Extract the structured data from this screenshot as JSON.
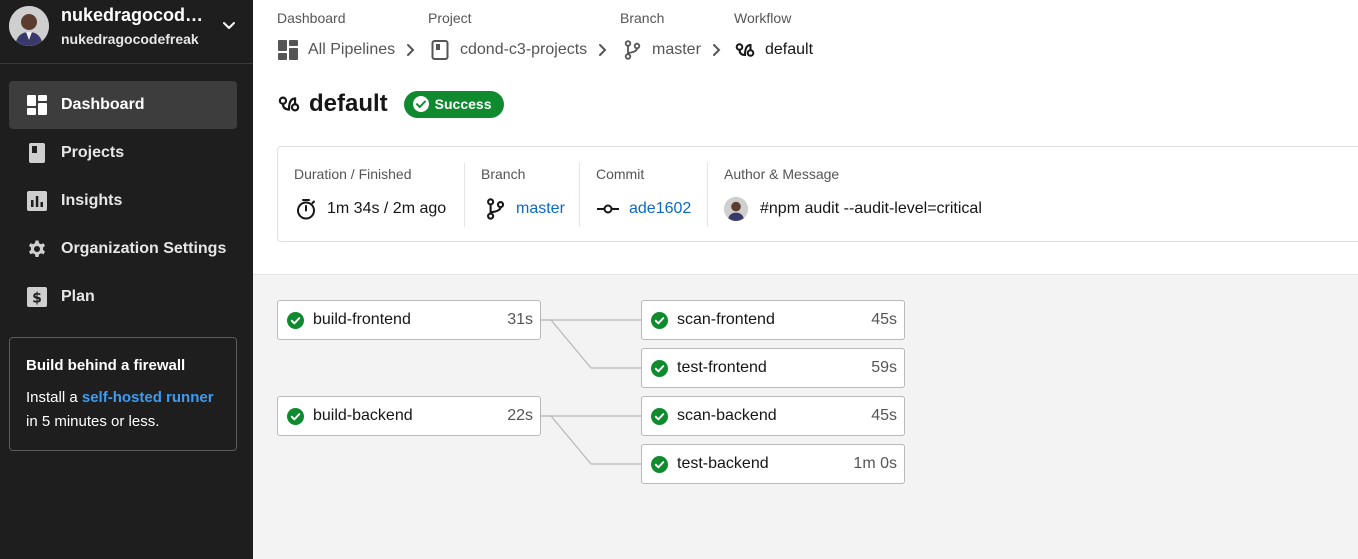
{
  "user": {
    "display_name": "nukedragocodefreak",
    "username": "nukedragocodefreak"
  },
  "nav": {
    "items": [
      {
        "label": "Dashboard",
        "icon": "dashboard-icon",
        "active": true
      },
      {
        "label": "Projects",
        "icon": "projects-icon",
        "active": false
      },
      {
        "label": "Insights",
        "icon": "insights-icon",
        "active": false
      },
      {
        "label": "Organization Settings",
        "icon": "gear-icon",
        "active": false
      },
      {
        "label": "Plan",
        "icon": "dollar-icon",
        "active": false
      }
    ]
  },
  "promo": {
    "title": "Build behind a firewall",
    "text_before": "Install a ",
    "link": "self-hosted runner",
    "text_after": " in 5 minutes or less."
  },
  "breadcrumb": {
    "items": [
      {
        "caption": "Dashboard",
        "label": "All Pipelines",
        "icon": "pipelines-icon"
      },
      {
        "caption": "Project",
        "label": "cdond-c3-projects",
        "icon": "project-icon"
      },
      {
        "caption": "Branch",
        "label": "master",
        "icon": "branch-icon"
      },
      {
        "caption": "Workflow",
        "label": "default",
        "icon": "workflow-icon"
      }
    ]
  },
  "workflow": {
    "name": "default",
    "status": "Success"
  },
  "info": {
    "duration_caption": "Duration / Finished",
    "duration_value": "1m 34s / 2m ago",
    "branch_caption": "Branch",
    "branch_value": "master",
    "commit_caption": "Commit",
    "commit_value": "ade1602",
    "author_caption": "Author & Message",
    "message": "#npm audit --audit-level=critical"
  },
  "jobs": [
    {
      "name": "build-frontend",
      "duration": "31s",
      "status": "success"
    },
    {
      "name": "scan-frontend",
      "duration": "45s",
      "status": "success"
    },
    {
      "name": "test-frontend",
      "duration": "59s",
      "status": "success"
    },
    {
      "name": "build-backend",
      "duration": "22s",
      "status": "success"
    },
    {
      "name": "scan-backend",
      "duration": "45s",
      "status": "success"
    },
    {
      "name": "test-backend",
      "duration": "1m 0s",
      "status": "success"
    }
  ],
  "colors": {
    "sidebar_bg": "#1e1e1e",
    "active_nav": "#3d3d3d",
    "success": "#0f8a2e",
    "link": "#0b6ac4",
    "promo_link": "#3d9cf0"
  }
}
